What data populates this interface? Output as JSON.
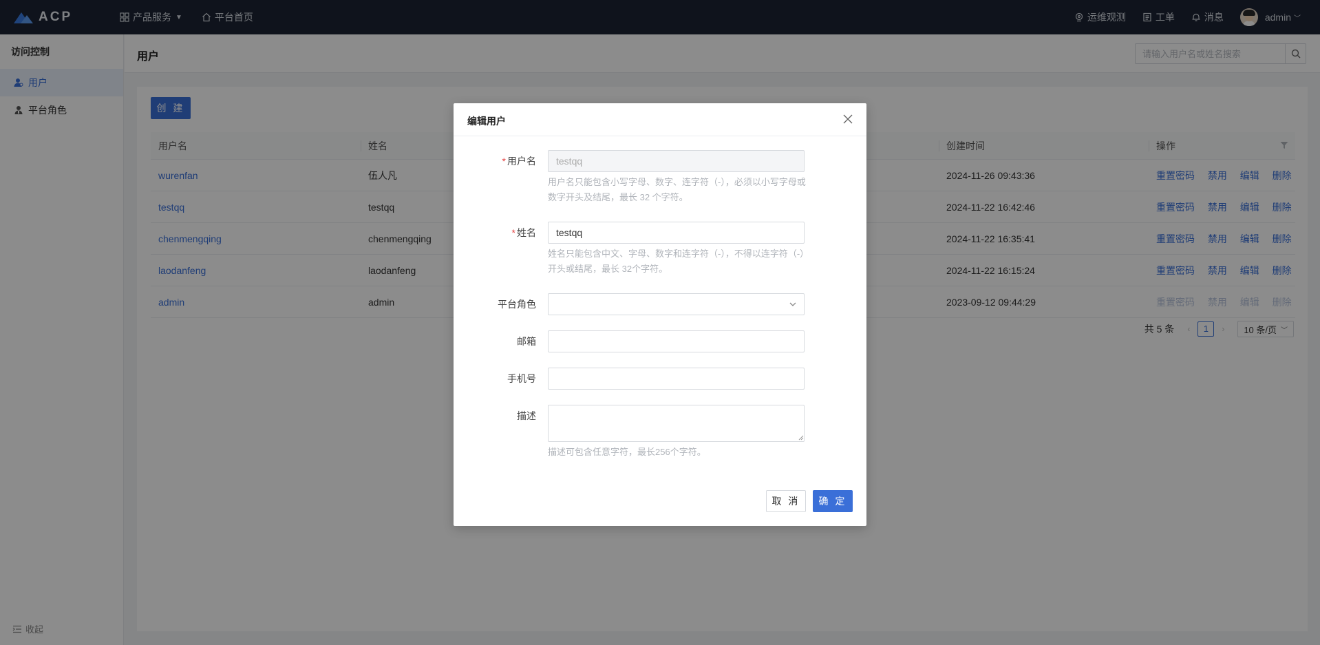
{
  "app": {
    "logo_text": "ACP",
    "accent_color": "#3a6fd8",
    "topbar_color": "#1c2433"
  },
  "topnav": {
    "products": "产品服务",
    "home": "平台首页",
    "ops_observe": "运维观测",
    "tickets": "工单",
    "messages": "消息",
    "user": "admin"
  },
  "sidebar": {
    "title": "访问控制",
    "items": [
      {
        "label": "用户",
        "icon": "user-icon",
        "active": true
      },
      {
        "label": "平台角色",
        "icon": "role-icon",
        "active": false
      }
    ],
    "collapse": "收起"
  },
  "page": {
    "title": "用户",
    "search_placeholder": "请输入用户名或姓名搜索",
    "create_label": "创 建"
  },
  "table": {
    "columns": [
      "用户名",
      "姓名",
      "",
      "创建时间",
      "操作"
    ],
    "rows": [
      {
        "username": "wurenfan",
        "name": "伍人凡",
        "created": "2024-11-26 09:43:36",
        "disabled": false
      },
      {
        "username": "testqq",
        "name": "testqq",
        "created": "2024-11-22 16:42:46",
        "disabled": false
      },
      {
        "username": "chenmengqing",
        "name": "chenmengqing",
        "created": "2024-11-22 16:35:41",
        "disabled": false
      },
      {
        "username": "laodanfeng",
        "name": "laodanfeng",
        "created": "2024-11-22 16:15:24",
        "disabled": false
      },
      {
        "username": "admin",
        "name": "admin",
        "created": "2023-09-12 09:44:29",
        "disabled": true
      }
    ],
    "actions": [
      "重置密码",
      "禁用",
      "编辑",
      "删除"
    ]
  },
  "pagination": {
    "total": "共 5 条",
    "current": "1",
    "page_size": "10 条/页"
  },
  "modal": {
    "title": "编辑用户",
    "username_label": "用户名",
    "username_value": "testqq",
    "username_hint": "用户名只能包含小写字母、数字、连字符（-），必须以小写字母或数字开头及结尾，最长 32 个字符。",
    "name_label": "姓名",
    "name_value": "testqq",
    "name_hint": "姓名只能包含中文、字母、数字和连字符（-），不得以连字符（-）开头或结尾，最长 32个字符。",
    "role_label": "平台角色",
    "role_value": "",
    "email_label": "邮箱",
    "email_value": "",
    "phone_label": "手机号",
    "phone_value": "",
    "desc_label": "描述",
    "desc_value": "",
    "desc_hint": "描述可包含任意字符，最长256个字符。",
    "required_mark": "*",
    "cancel_label": "取 消",
    "ok_label": "确 定"
  }
}
